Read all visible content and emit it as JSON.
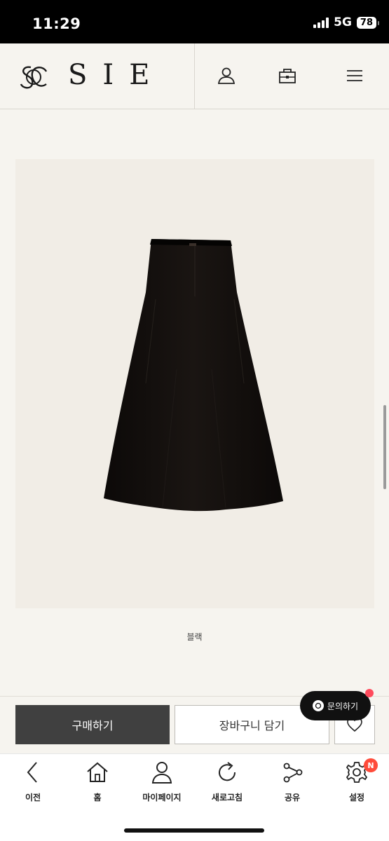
{
  "status_bar": {
    "time": "11:29",
    "network": "5G",
    "battery": "78"
  },
  "header": {
    "brand_name": "SIE",
    "icons": [
      "user-icon",
      "bag-icon",
      "menu-icon"
    ]
  },
  "product": {
    "color_label": "블랙"
  },
  "actions": {
    "buy_label": "구매하기",
    "cart_label": "장바구니 담기"
  },
  "inquiry": {
    "label": "문의하기"
  },
  "bottom_nav": {
    "items": [
      {
        "label": "이전",
        "icon": "back-icon"
      },
      {
        "label": "홈",
        "icon": "home-icon"
      },
      {
        "label": "마이페이지",
        "icon": "person-icon"
      },
      {
        "label": "새로고침",
        "icon": "refresh-icon"
      },
      {
        "label": "공유",
        "icon": "share-icon"
      },
      {
        "label": "설정",
        "icon": "gear-icon"
      }
    ],
    "settings_badge": "N"
  },
  "colors": {
    "page_bg": "#f6f4ef",
    "buy_button_bg": "#404040",
    "badge_red": "#ff4b3a"
  }
}
